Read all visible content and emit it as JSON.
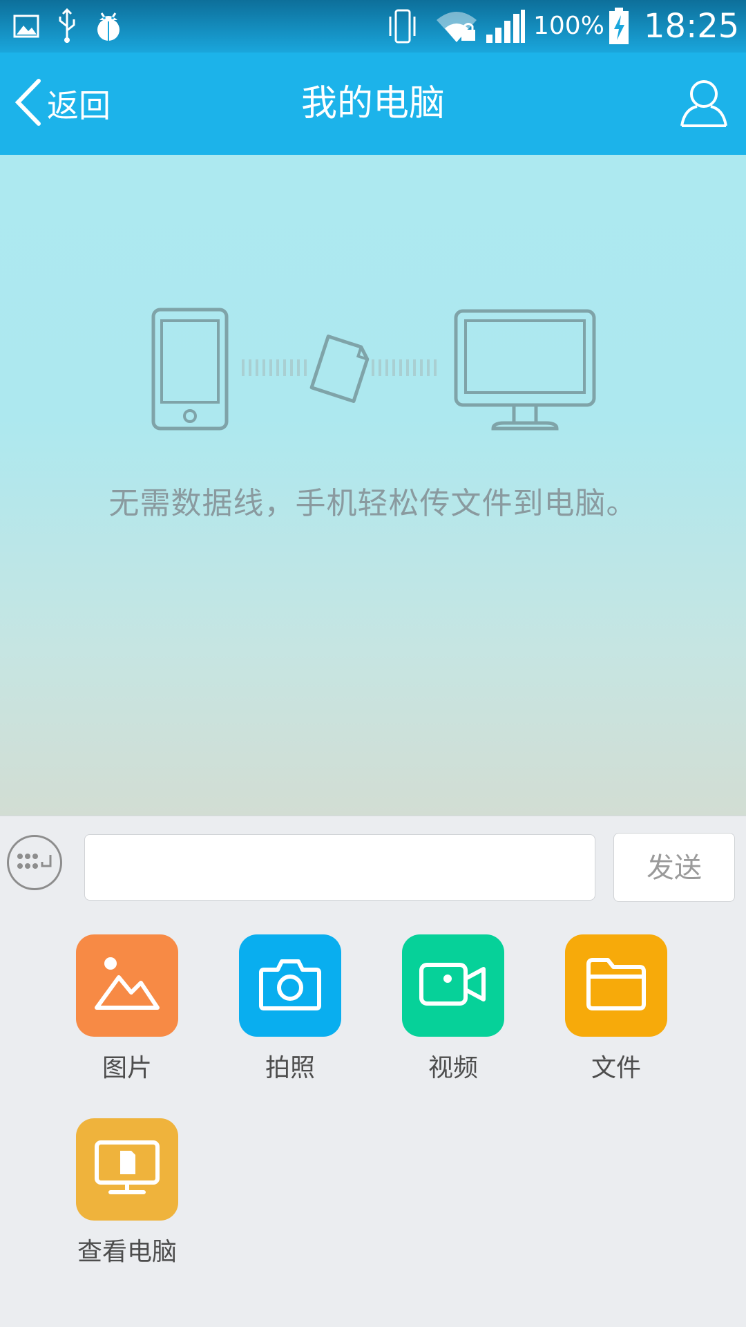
{
  "status_bar": {
    "icons": [
      "gallery-notification-icon",
      "usb-icon",
      "debug-bug-icon",
      "vibrate-icon",
      "wifi-locked-icon",
      "signal-icon",
      "battery-charging-icon"
    ],
    "battery": "100%",
    "time": "18:25"
  },
  "title_bar": {
    "back_label": "返回",
    "title": "我的电脑",
    "user_icon": "user-icon"
  },
  "hero": {
    "graphic": "phone-to-computer-transfer-illustration",
    "text": "无需数据线，手机轻松传文件到电脑。"
  },
  "input_bar": {
    "keyboard_icon": "keyboard-icon",
    "input_value": "",
    "input_placeholder": "",
    "send_label": "发送"
  },
  "actions": [
    {
      "label": "图片",
      "icon": "image-icon",
      "color": "#f78a45"
    },
    {
      "label": "拍照",
      "icon": "camera-icon",
      "color": "#09aeef"
    },
    {
      "label": "视频",
      "icon": "video-icon",
      "color": "#06d199"
    },
    {
      "label": "文件",
      "icon": "folder-icon",
      "color": "#f7aa0a"
    },
    {
      "label": "查看电脑",
      "icon": "view-computer-icon",
      "color": "#efb33c"
    }
  ],
  "colors": {
    "title_bar": "#1cb3ea",
    "content_gradient_top": "#ade9f0",
    "content_gradient_bottom": "#d2ddd3",
    "background": "#ebedf0"
  }
}
